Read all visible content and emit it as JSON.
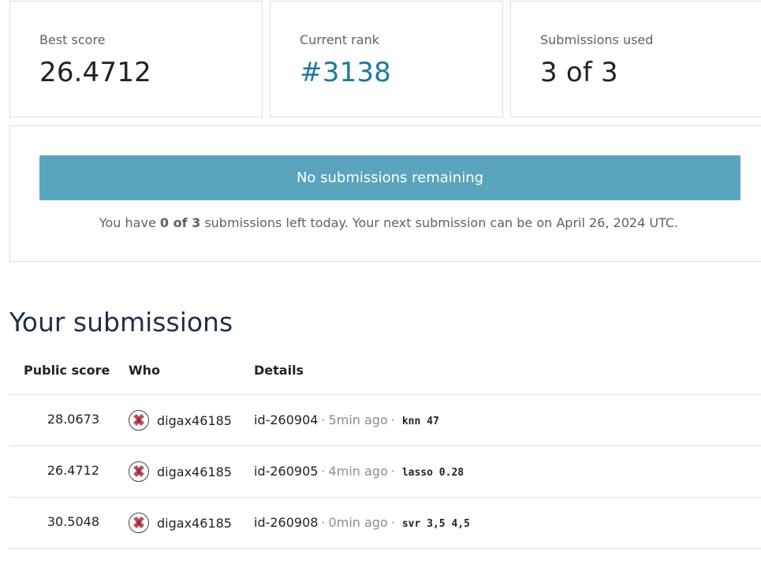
{
  "stats": {
    "best_score": {
      "label": "Best score",
      "value": "26.4712"
    },
    "current_rank": {
      "label": "Current rank",
      "value": "#3138"
    },
    "submissions_used": {
      "label": "Submissions used",
      "value": "3 of 3"
    }
  },
  "status": {
    "banner_label": "No submissions remaining",
    "message_prefix": "You have",
    "message_count": "0 of 3",
    "message_suffix": "submissions left today. Your next submission can be on April 26, 2024 UTC."
  },
  "colors": {
    "banner_bg": "#5aa5bd",
    "rank_accent": "#1a7aa0",
    "title_color": "#1f3048"
  },
  "submissions": {
    "title": "Your submissions",
    "columns": [
      "Public score",
      "Who",
      "Details"
    ],
    "rows": [
      {
        "score": "28.0673",
        "who": "digax46185",
        "id": "id-260904",
        "ago": "5min ago",
        "note": "knn 47",
        "avatar_icon": "identicon-avatar-icon"
      },
      {
        "score": "26.4712",
        "who": "digax46185",
        "id": "id-260905",
        "ago": "4min ago",
        "note": "lasso 0.28",
        "avatar_icon": "identicon-avatar-icon"
      },
      {
        "score": "30.5048",
        "who": "digax46185",
        "id": "id-260908",
        "ago": "0min ago",
        "note": "svr 3,5 4,5",
        "avatar_icon": "identicon-avatar-icon"
      }
    ]
  }
}
